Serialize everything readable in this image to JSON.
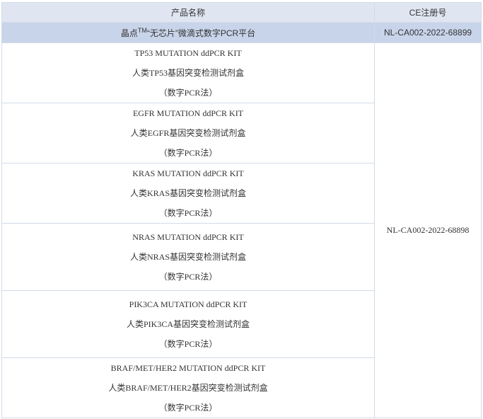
{
  "table": {
    "header": {
      "product_name": "产品名称",
      "ce_number": "CE注册号"
    },
    "highlight_row": {
      "product_pre": "晶点",
      "trademark": "TM",
      "product_post": "“无芯片”微滴式数字PCR平台",
      "ce": "NL-CA002-2022-68899"
    },
    "kits": [
      {
        "en": "TP53 MUTATION ddPCR KIT",
        "cn": "人类TP53基因突变检测试剂盒",
        "method": "（数字PCR法）"
      },
      {
        "en": "EGFR MUTATION ddPCR KIT",
        "cn": "人类EGFR基因突变检测试剂盒",
        "method": "（数字PCR法）"
      },
      {
        "en": "KRAS MUTATION ddPCR KIT",
        "cn": "人类KRAS基因突变检测试剂盒",
        "method": "（数字PCR法）"
      },
      {
        "en": "NRAS MUTATION ddPCR KIT",
        "cn": "人类NRAS基因突变检测试剂盒",
        "method": "（数字PCR法）"
      },
      {
        "en": "PIK3CA MUTATION ddPCR KIT",
        "cn": "人类PIK3CA基因突变检测试剂盒",
        "method": "（数字PCR法）"
      },
      {
        "en": "BRAF/MET/HER2 MUTATION ddPCR KIT",
        "cn": "人类BRAF/MET/HER2基因突变检测试剂盒",
        "method": "（数字PCR法）"
      }
    ],
    "kits_ce": "NL-CA002-2022-68898"
  }
}
